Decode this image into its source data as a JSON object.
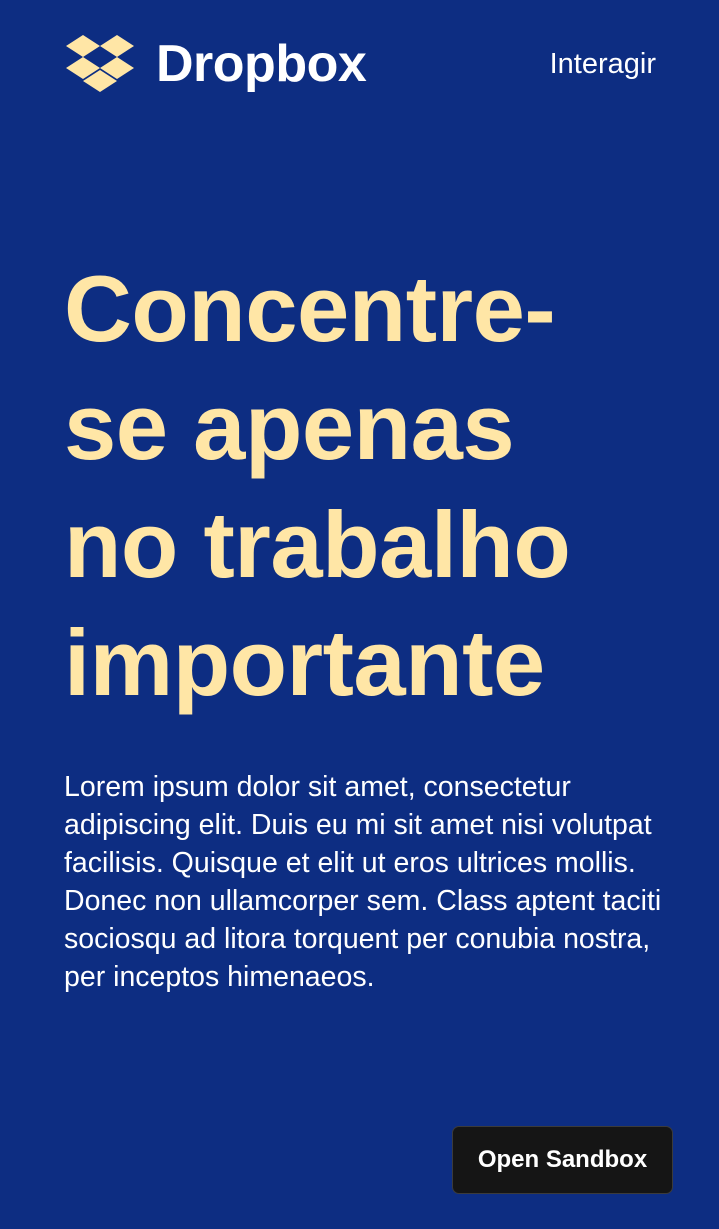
{
  "header": {
    "logo_text": "Dropbox",
    "logo_icon": "dropbox-icon",
    "nav_link": "Interagir"
  },
  "hero": {
    "title_lines": [
      "Concentre-",
      "se apenas",
      "no trabalho",
      "importante"
    ],
    "body": "Lorem ipsum dolor sit amet, consectetur adipiscing elit. Duis eu mi sit amet nisi volutpat facilisis. Quisque et elit ut eros ultrices mollis. Donec non ullamcorper sem. Class aptent taciti sociosqu ad litora torquent per conubia nostra, per inceptos himenaeos."
  },
  "sandbox_button": {
    "label": "Open Sandbox"
  },
  "colors": {
    "background": "#0d2d82",
    "accent": "#ffe6a6",
    "text": "#ffffff",
    "button_background": "#151515"
  }
}
